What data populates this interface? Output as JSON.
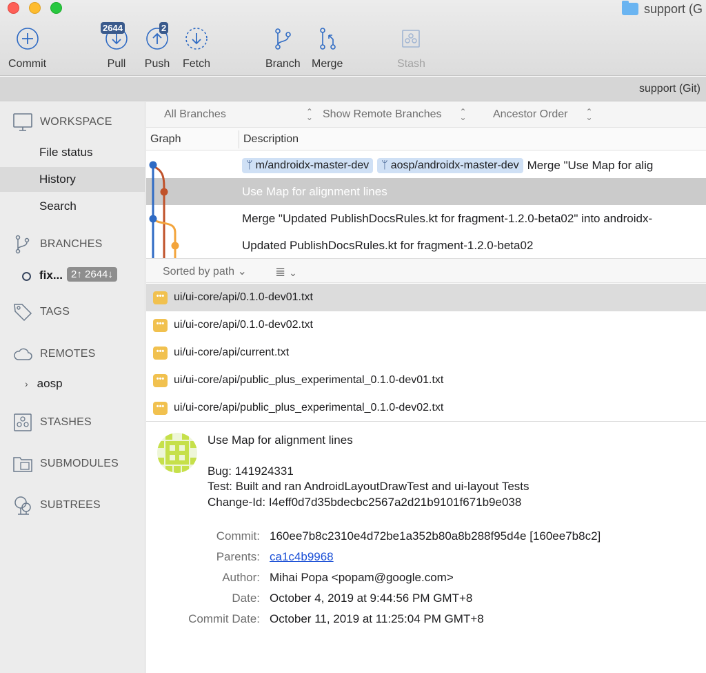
{
  "window": {
    "title": "support (G"
  },
  "toolbar": {
    "commit": "Commit",
    "pull": "Pull",
    "pull_badge": "2644",
    "push": "Push",
    "push_badge": "2",
    "fetch": "Fetch",
    "branch": "Branch",
    "merge": "Merge",
    "stash": "Stash"
  },
  "subtitle": "support (Git)",
  "sidebar": {
    "workspace": "WORKSPACE",
    "file_status": "File status",
    "history": "History",
    "search": "Search",
    "branches": "BRANCHES",
    "current_branch": "fix...",
    "current_branch_counts": "2↑ 2644↓",
    "tags": "TAGS",
    "remotes": "REMOTES",
    "remote_aosp": "aosp",
    "stashes": "STASHES",
    "submodules": "SUBMODULES",
    "subtrees": "SUBTREES"
  },
  "filters": {
    "branches": "All Branches",
    "remote": "Show Remote Branches",
    "order": "Ancestor Order"
  },
  "columns": {
    "graph": "Graph",
    "description": "Description"
  },
  "commits": [
    {
      "refs": [
        "m/androidx-master-dev",
        "aosp/androidx-master-dev"
      ],
      "message": "Merge \"Use Map for alig"
    },
    {
      "refs": [],
      "message": "Use Map for alignment lines"
    },
    {
      "refs": [],
      "message": "Merge \"Updated PublishDocsRules.kt for fragment-1.2.0-beta02\" into androidx-"
    },
    {
      "refs": [],
      "message": "Updated PublishDocsRules.kt for fragment-1.2.0-beta02"
    }
  ],
  "files_toolbar": {
    "sort": "Sorted by path"
  },
  "files": [
    "ui/ui-core/api/0.1.0-dev01.txt",
    "ui/ui-core/api/0.1.0-dev02.txt",
    "ui/ui-core/api/current.txt",
    "ui/ui-core/api/public_plus_experimental_0.1.0-dev01.txt",
    "ui/ui-core/api/public_plus_experimental_0.1.0-dev02.txt"
  ],
  "file_badge": "•••",
  "details": {
    "subject": "Use Map for alignment lines",
    "body": [
      "Bug: 141924331",
      "Test: Built and ran AndroidLayoutDrawTest and ui-layout Tests",
      "Change-Id: I4eff0d7d35bdecbc2567a2d21b9101f671b9e038"
    ],
    "labels": {
      "commit": "Commit:",
      "parents": "Parents:",
      "author": "Author:",
      "date": "Date:",
      "commit_date": "Commit Date:"
    },
    "commit": "160ee7b8c2310e4d72be1a352b80a8b288f95d4e [160ee7b8c2]",
    "parents": "ca1c4b9968",
    "author": "Mihai Popa <popam@google.com>",
    "date": "October 4, 2019 at 9:44:56 PM GMT+8",
    "commit_date": "October 11, 2019 at 11:25:04 PM GMT+8"
  },
  "colors": {
    "graph_blue": "#2f6bc4",
    "graph_red": "#c0522a",
    "graph_orange": "#f3a43b",
    "ref_pill": "#cfe0f5",
    "file_badge": "#f1c14f",
    "link": "#1a4fd6"
  }
}
